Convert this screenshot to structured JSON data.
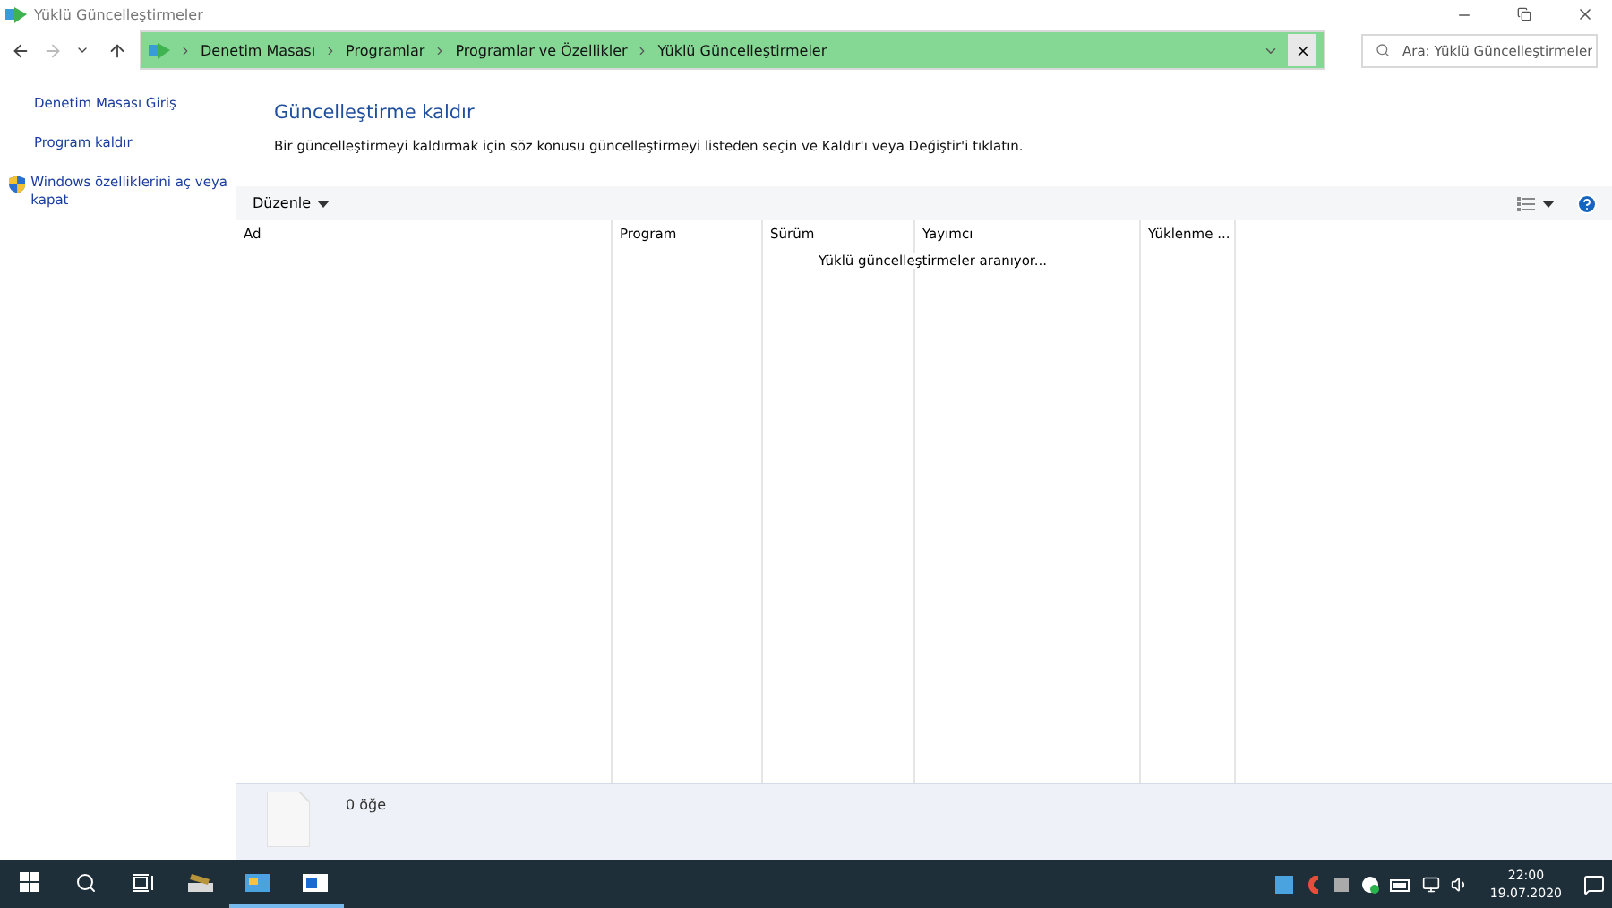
{
  "window": {
    "title": "Yüklü Güncelleştirmeler"
  },
  "breadcrumbs": [
    "Denetim Masası",
    "Programlar",
    "Programlar ve Özellikler",
    "Yüklü Güncelleştirmeler"
  ],
  "search": {
    "placeholder": "Ara: Yüklü Güncelleştirmeler"
  },
  "sidebar": {
    "items": [
      {
        "label": "Denetim Masası Giriş",
        "kind": "link"
      },
      {
        "label": "Program kaldır",
        "kind": "link"
      },
      {
        "label": "Windows özelliklerini aç veya kapat",
        "kind": "shield"
      }
    ]
  },
  "heading": "Güncelleştirme kaldır",
  "description": "Bir güncelleştirmeyi kaldırmak için söz konusu güncelleştirmeyi listeden seçin ve Kaldır'ı veya Değiştir'i tıklatın.",
  "toolbar": {
    "organize": "Düzenle"
  },
  "table": {
    "columns": [
      "Ad",
      "Program",
      "Sürüm",
      "Yayımcı",
      "Yüklenme ..."
    ],
    "status": "Yüklü güncelleştirmeler aranıyor..."
  },
  "details": {
    "count": "0 öğe"
  },
  "taskbar": {
    "time": "22:00",
    "date": "19.07.2020"
  }
}
